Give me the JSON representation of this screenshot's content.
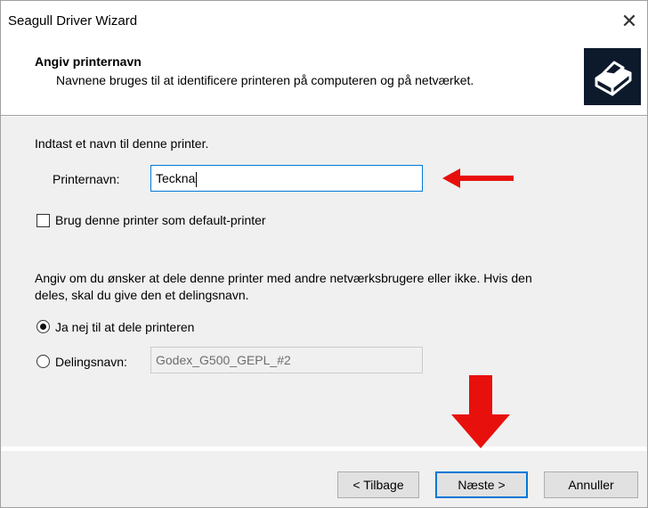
{
  "window": {
    "title": "Seagull Driver Wizard",
    "close_glyph": "✕"
  },
  "header": {
    "title": "Angiv printernavn",
    "subtitle": "Navnene bruges til at identificere printeren på computeren og på netværket.",
    "icon": "printer-icon"
  },
  "form": {
    "intro": "Indtast et navn til denne printer.",
    "printer_name_label": "Printernavn:",
    "printer_name_value": "Teckna",
    "default_printer_label": "Brug denne printer som default-printer",
    "default_printer_checked": false,
    "share_text_line1": "Angiv om du ønsker at dele denne printer med andre netværksbrugere eller ikke. Hvis den",
    "share_text_line2": "deles, skal du give den et delingsnavn.",
    "no_share_label": "Ja nej til at dele printeren",
    "share_name_label": "Delingsnavn:",
    "share_name_value": "Godex_G500_GEPL_#2",
    "selected_option": "no_share"
  },
  "buttons": {
    "back": "< Tilbage",
    "next": "Næste >",
    "cancel": "Annuller"
  },
  "annotations": {
    "arrow_color": "#e8100c"
  }
}
